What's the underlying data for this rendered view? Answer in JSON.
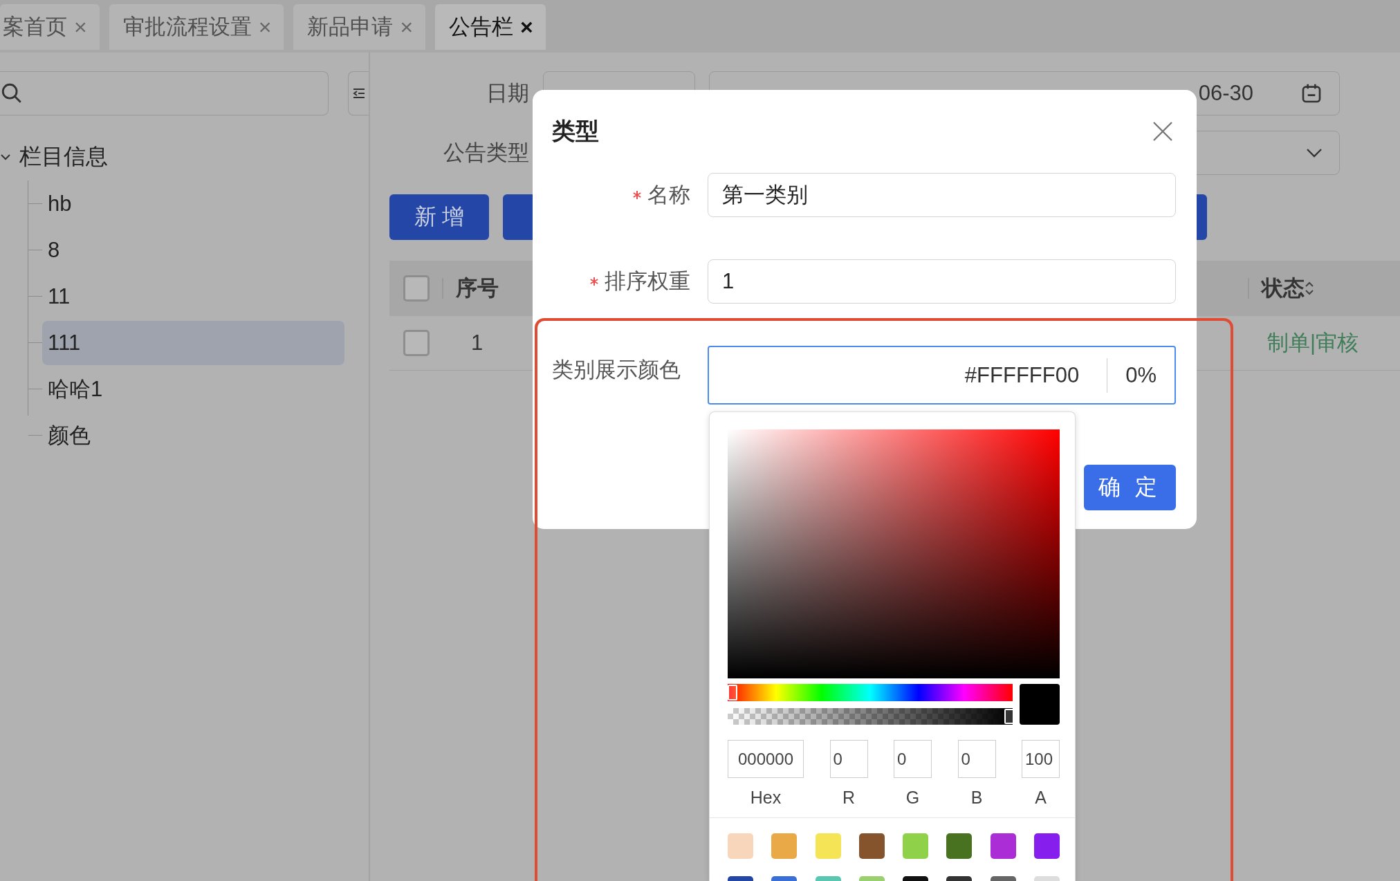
{
  "tabs": [
    {
      "label": "案首页",
      "close": "×",
      "selected": false
    },
    {
      "label": "审批流程设置",
      "close": "×",
      "selected": false
    },
    {
      "label": "新品申请",
      "close": "×",
      "selected": false
    },
    {
      "label": "公告栏",
      "close": "×",
      "selected": true
    }
  ],
  "sidebar": {
    "tree": {
      "label": "栏目信息",
      "expanded": true,
      "children": [
        {
          "label": "hb",
          "selected": false
        },
        {
          "label": "8",
          "selected": false
        },
        {
          "label": "11",
          "selected": false
        },
        {
          "label": "111",
          "selected": true
        },
        {
          "label": "哈哈1",
          "selected": false
        },
        {
          "label": "颜色",
          "selected": false
        }
      ]
    }
  },
  "filters": {
    "date_label": "日期",
    "date_end": "06-30",
    "type_label": "公告类型"
  },
  "toolbar": {
    "buttons": [
      "新 增"
    ]
  },
  "table": {
    "header_checked": false,
    "columns": [
      "序号",
      "状态"
    ],
    "rows": [
      {
        "checked": false,
        "cells": [
          "1",
          "制单|审核"
        ]
      }
    ]
  },
  "dialog": {
    "title": "类型",
    "fields": [
      {
        "kind": "text",
        "label": "名称",
        "required": true,
        "value": "第一类别"
      },
      {
        "kind": "text",
        "label": "排序权重",
        "required": true,
        "value": "1"
      },
      {
        "kind": "color",
        "label": "类别展示颜色",
        "required": false,
        "value": "#FFFFFF00",
        "alpha": "0%"
      }
    ],
    "confirm": "确 定"
  },
  "color_picker": {
    "hue": {
      "level": 0
    },
    "alpha": {
      "level": 1
    },
    "preview": {
      "color": "#000000"
    },
    "inputs": [
      {
        "label": "Hex",
        "value": "000000"
      },
      {
        "label": "R",
        "value": "0"
      },
      {
        "label": "G",
        "value": "0"
      },
      {
        "label": "B",
        "value": "0"
      },
      {
        "label": "A",
        "value": "100"
      }
    ],
    "swatches": [
      {
        "color": "#f8d6bc"
      },
      {
        "color": "#e9a946"
      },
      {
        "color": "#f4e456"
      },
      {
        "color": "#85542c"
      },
      {
        "color": "#8fd24a"
      },
      {
        "color": "#48721f"
      },
      {
        "color": "#aa2dd5"
      },
      {
        "color": "#861fee"
      },
      {
        "color": "#2446a6"
      },
      {
        "color": "#3a6fd8"
      },
      {
        "color": "#5ac8b0"
      },
      {
        "color": "#9ad070"
      },
      {
        "color": "#111111"
      },
      {
        "color": "#333333"
      },
      {
        "color": "#666666"
      },
      {
        "color": "#dddddd"
      }
    ]
  }
}
